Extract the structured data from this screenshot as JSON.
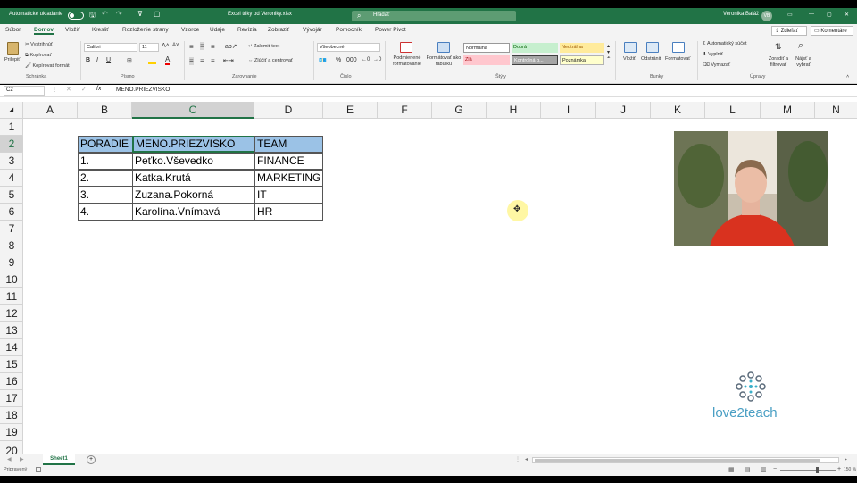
{
  "titlebar": {
    "autosave_label": "Automatické ukladanie",
    "file_name": "Excel triky od Veroniky.xlsx",
    "search_placeholder": "Hľadať",
    "user_name": "Veronika Baláž",
    "user_initials": "VB"
  },
  "tabs": [
    "Súbor",
    "Domov",
    "Vložiť",
    "Kresliť",
    "Rozloženie strany",
    "Vzorce",
    "Údaje",
    "Revízia",
    "Zobraziť",
    "Vývojár",
    "Pomocník",
    "Power Pivot"
  ],
  "share_label": "Zdieľať",
  "comments_label": "Komentáre",
  "ribbon": {
    "paste": "Prilepiť",
    "cut": "Vystrihnúť",
    "copy": "Kopírovať",
    "format_painter": "Kopírovať formát",
    "clipboard_group": "Schránka",
    "font_name": "Calibri",
    "font_size": "11",
    "font_group": "Písmo",
    "wrap_text": "Zalomiť text",
    "merge_center": "Zlúčiť a centrovať",
    "alignment_group": "Zarovnanie",
    "number_format": "Všeobecné",
    "number_group": "Číslo",
    "conditional_formatting": "Podmienené formátovanie",
    "format_as_table": "Formátovať ako tabuľku",
    "styles_group": "Štýly",
    "styles": {
      "normal": "Normálna",
      "good": "Dobrá",
      "neutral": "Neutrálna",
      "bad": "Zlá",
      "check": "Kontrolná b...",
      "note": "Poznámka"
    },
    "insert": "Vložiť",
    "delete": "Odstrániť",
    "format": "Formátovať",
    "cells_group": "Bunky",
    "autosum": "Automatický súčet",
    "fill": "Vyplniť",
    "clear": "Vymazať",
    "sort_filter": "Zoradiť a filtrovať",
    "find_select": "Nájsť a vybrať",
    "editing_group": "Úpravy"
  },
  "formula_bar": {
    "name_box": "C2",
    "fx": "fx",
    "content": "MENO.PRIEZVISKO"
  },
  "columns": [
    "A",
    "B",
    "C",
    "D",
    "E",
    "F",
    "G",
    "H",
    "I",
    "J",
    "K",
    "L",
    "M",
    "N"
  ],
  "rows": [
    "1",
    "2",
    "3",
    "4",
    "5",
    "6",
    "7",
    "8",
    "9",
    "10",
    "11",
    "12",
    "13",
    "14",
    "15",
    "16",
    "17",
    "18",
    "19",
    "20"
  ],
  "table": {
    "headers": [
      "PORADIE",
      "MENO.PRIEZVISKO",
      "TEAM"
    ],
    "rows": [
      [
        "1.",
        "Peťko.Vševedko",
        "FINANCE"
      ],
      [
        "2.",
        "Katka.Krutá",
        "MARKETING"
      ],
      [
        "3.",
        "Zuzana.Pokorná",
        "IT"
      ],
      [
        "4.",
        "Karolína.Vnímavá",
        "HR"
      ]
    ]
  },
  "watermark": "love2teach",
  "sheet_tab": "Sheet1",
  "status": {
    "ready": "Pripravený",
    "zoom": "150 %"
  },
  "colors": {
    "excel_green": "#217346",
    "header_fill": "#9bc2e6",
    "good": "#c6efce",
    "bad": "#ffc7ce",
    "neutral": "#ffeb9c",
    "check": "#a5a5a5",
    "note": "#ffffcc"
  }
}
